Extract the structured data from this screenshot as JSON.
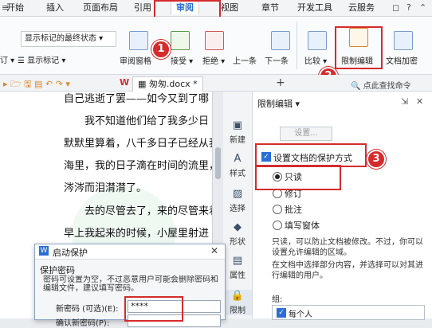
{
  "menu": {
    "items": [
      "开始",
      "插入",
      "页面布局",
      "引用",
      "审阅",
      "视图",
      "章节",
      "开发工具",
      "云服务"
    ],
    "active": "审阅"
  },
  "ribbon": {
    "markup_dropdown": "显示标记的最终状态",
    "show_markup": "显示标记",
    "track_prefix": "订",
    "review_pane": "审阅窗格",
    "accept": "接受",
    "reject": "拒绝",
    "previous": "上一条",
    "next": "下一条",
    "compare": "比较",
    "restrict_edit": "限制编辑",
    "doc_encrypt": "文档加密"
  },
  "quickbar": {
    "doc_tab": "匆匆.docx *",
    "search_cmd": "点此查找命令"
  },
  "document": {
    "lines": [
      "自己逃逝了罢——如今又到了哪",
      "我不知道他们给了我多少日",
      "默默里算着，八千多日子已经从我",
      "海里，我的日子滴在时间的流里，",
      "涔涔而泪潸潸了。",
      "去的尽管去了，来的尽管来着",
      "早上我起来的时候，小屋里射进"
    ]
  },
  "sidebar": {
    "items": [
      "新建",
      "样式",
      "选择",
      "形状",
      "属性",
      "限制"
    ]
  },
  "panel": {
    "title": "限制编辑",
    "settings_button": "设置...",
    "protect_label": "设置文档的保护方式",
    "options": [
      "只读",
      "修订",
      "批注",
      "填写窗体"
    ],
    "selected": "只读",
    "desc_1": "只读，可以防止文档被修改。不过，你可以设置允许编辑的区域。",
    "desc_2": "在文档中选择部分内容，并选择可以对其进行编辑的用户。",
    "group_label": "组:",
    "everyone": "每个人"
  },
  "dialog": {
    "title": "启动保护",
    "section": "保护密码",
    "note": "密码可设置为空，不过恶意用户可能会删除密码和编辑文件，建议填写密码。",
    "new_password_label": "新密码 (可选)(E):",
    "new_password_value": "****",
    "confirm_password_label": "确认新密码(P):"
  },
  "callouts": [
    "1",
    "2",
    "3"
  ],
  "colors": {
    "accent": "#2b6fd6",
    "callout": "#d62b2b",
    "restrict_icon": "#d9862b"
  }
}
